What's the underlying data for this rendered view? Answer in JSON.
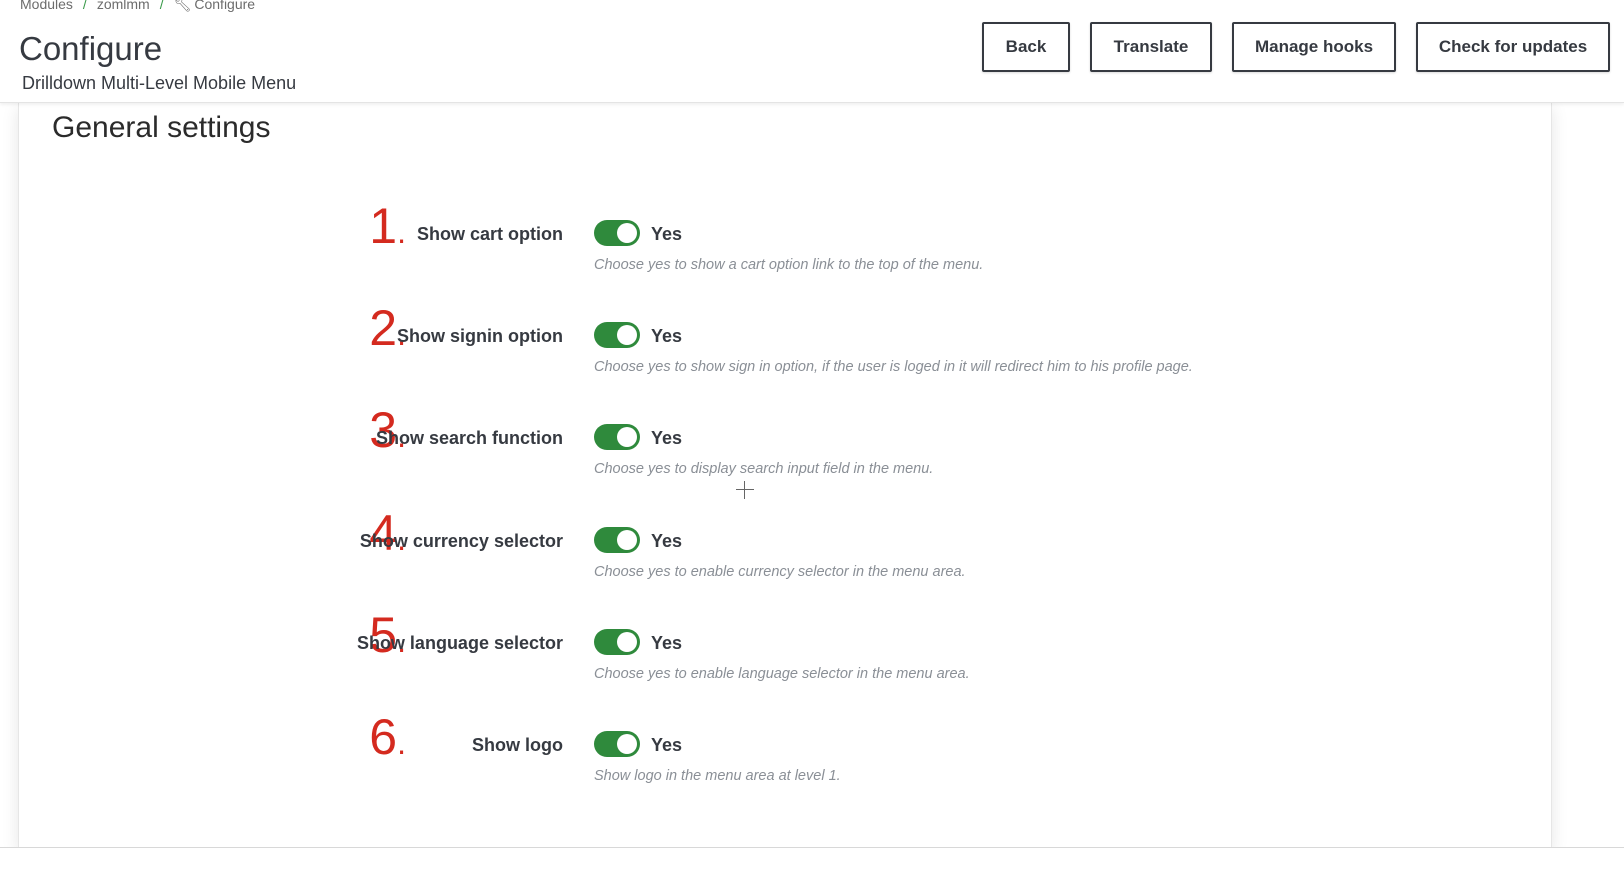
{
  "breadcrumb": {
    "items": [
      "Modules",
      "zomlmm",
      "Configure"
    ]
  },
  "header": {
    "title": "Configure",
    "subtitle": "Drilldown Multi-Level Mobile Menu"
  },
  "toolbar": {
    "back_label": "Back",
    "translate_label": "Translate",
    "hooks_label": "Manage hooks",
    "updates_label": "Check for updates"
  },
  "panel": {
    "title": "General settings"
  },
  "settings": [
    {
      "number": "1",
      "label": "Show cart option",
      "value": "Yes",
      "enabled": true,
      "help": "Choose yes to show a cart option link to the top of the menu."
    },
    {
      "number": "2",
      "label": "Show signin option",
      "value": "Yes",
      "enabled": true,
      "help": "Choose yes to show sign in option, if the user is loged in it will redirect him to his profile page."
    },
    {
      "number": "3",
      "label": "Show search function",
      "value": "Yes",
      "enabled": true,
      "help": "Choose yes to display search input field in the menu."
    },
    {
      "number": "4",
      "label": "Show currency selector",
      "value": "Yes",
      "enabled": true,
      "help": "Choose yes to enable currency selector in the menu area."
    },
    {
      "number": "5",
      "label": "Show language selector",
      "value": "Yes",
      "enabled": true,
      "help": "Choose yes to enable language selector in the menu area."
    },
    {
      "number": "6",
      "label": "Show logo",
      "value": "Yes",
      "enabled": true,
      "help": "Show logo in the menu area at level 1."
    }
  ],
  "colors": {
    "toggle_on": "#2f8a3c",
    "annotation_red": "#d42a1f",
    "breadcrumb_separator": "#3a9a4a"
  }
}
